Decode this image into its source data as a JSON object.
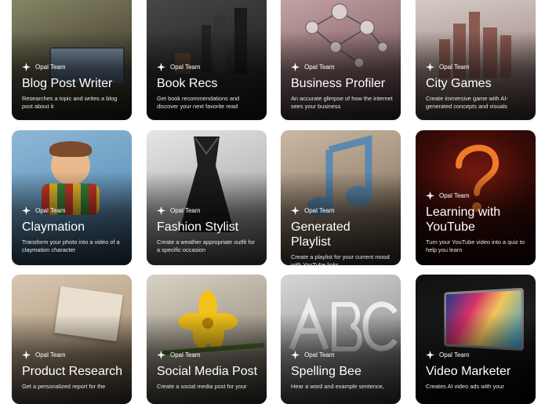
{
  "cards": [
    {
      "team": "Opal Team",
      "title": "Blog Post Writer",
      "desc": "Researches a topic and writes a blog post about it"
    },
    {
      "team": "Opal Team",
      "title": "Book Recs",
      "desc": "Get book recommendations and discover your next favorite read"
    },
    {
      "team": "Opal Team",
      "title": "Business Profiler",
      "desc": "An accurate glimpse of how the internet sees your business"
    },
    {
      "team": "Opal Team",
      "title": "City Games",
      "desc": "Create immersive game with AI-generated concepts and visuals"
    },
    {
      "team": "Opal Team",
      "title": "Claymation",
      "desc": "Transform your photo into a video of a claymation character"
    },
    {
      "team": "Opal Team",
      "title": "Fashion Stylist",
      "desc": "Create a weather appropriate outfit for a specific occasion"
    },
    {
      "team": "Opal Team",
      "title": "Generated Playlist",
      "desc": "Create a playlist for your current mood with YouTube links"
    },
    {
      "team": "Opal Team",
      "title": "Learning with YouTube",
      "desc": "Turn your YouTube video into a quiz to help you learn"
    },
    {
      "team": "Opal Team",
      "title": "Product Research",
      "desc": "Get a personalized report for the"
    },
    {
      "team": "Opal Team",
      "title": "Social Media Post",
      "desc": "Create a social media post for your"
    },
    {
      "team": "Opal Team",
      "title": "Spelling Bee",
      "desc": "Hear a word and example sentence,"
    },
    {
      "team": "Opal Team",
      "title": "Video Marketer",
      "desc": "Creates AI video ads with your"
    }
  ],
  "icons": {
    "team_icon": "sparkle-icon"
  }
}
